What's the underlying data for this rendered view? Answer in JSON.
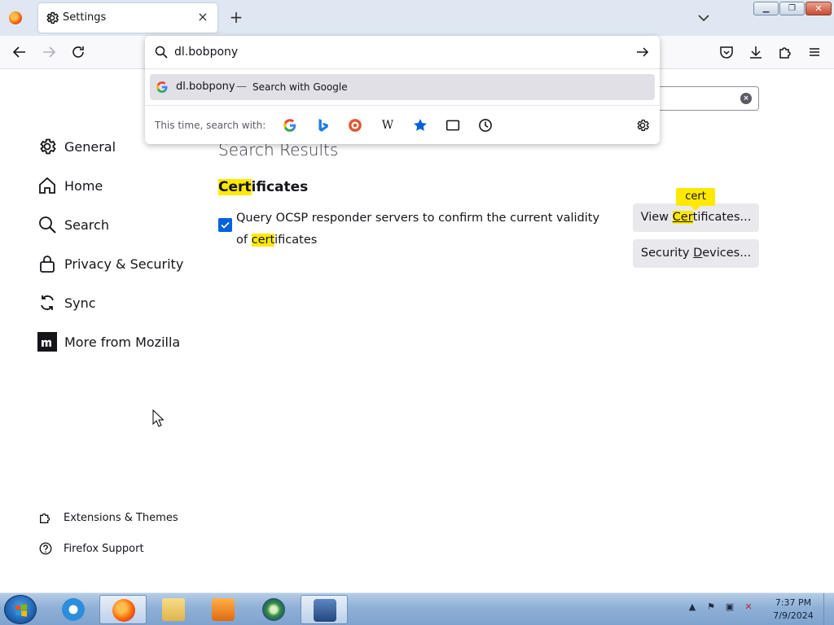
{
  "browser": {
    "tab_title": "Settings",
    "tab_close": "×",
    "new_tab": "+"
  },
  "urlbar": {
    "value": "dl.bobpony",
    "suggestion_text": "dl.bobpony",
    "suggestion_dash": "—",
    "suggestion_action": "Search with Google",
    "oneoff_label": "This time, search with:",
    "oneoff_wikipedia": "W"
  },
  "sidebar": {
    "items": [
      {
        "label": "General",
        "icon": "gear-icon"
      },
      {
        "label": "Home",
        "icon": "home-icon"
      },
      {
        "label": "Search",
        "icon": "search-icon"
      },
      {
        "label": "Privacy & Security",
        "icon": "lock-icon"
      },
      {
        "label": "Sync",
        "icon": "sync-icon"
      },
      {
        "label": "More from Mozilla",
        "icon": "mozilla-icon"
      }
    ],
    "footer": [
      {
        "label": "Extensions & Themes",
        "icon": "puzzle-icon"
      },
      {
        "label": "Firefox Support",
        "icon": "help-icon"
      }
    ]
  },
  "main": {
    "results_title": "Search Results",
    "heading_highlight": "Cert",
    "heading_rest": "ificates",
    "ocsp_label_part1": "Query OCSP responder servers to confirm the current validity of ",
    "ocsp_label_highlight": "cert",
    "ocsp_label_part2": "ificates",
    "ocsp_checked": true,
    "view_btn_prefix": "View ",
    "view_btn_highlight": "Cer",
    "view_btn_rest": "tificates...",
    "security_btn_prefix": "Security ",
    "security_btn_accel": "D",
    "security_btn_rest": "evices...",
    "tooltip": "cert",
    "find_clear": "×"
  },
  "taskbar": {
    "time": "7:37 PM",
    "date": "7/9/2024"
  },
  "colors": {
    "highlight": "#ffe900",
    "accent": "#0061e0",
    "button_bg": "#e9e9ed",
    "suggestion_bg": "#e0e0e6"
  }
}
